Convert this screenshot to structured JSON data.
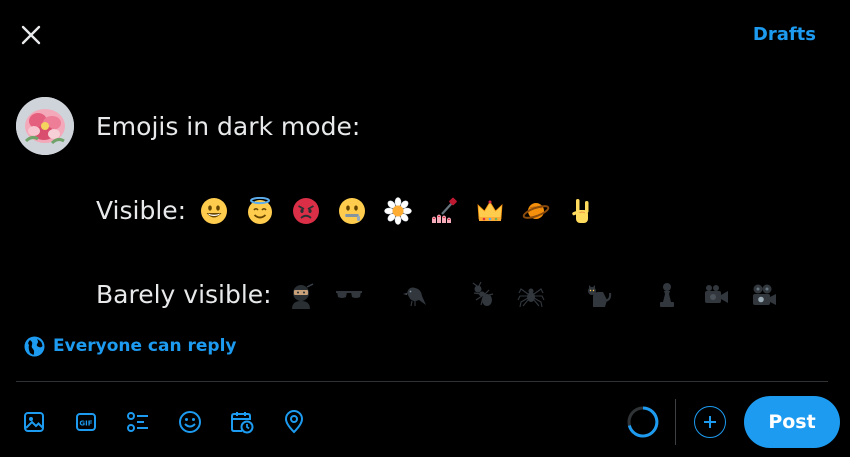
{
  "header": {
    "drafts_label": "Drafts",
    "close_icon": "close-icon"
  },
  "compose": {
    "line1": "Emojis in dark mode:",
    "visible_label": "Visible:",
    "visible_emojis": [
      "grinning-face",
      "smiling-face-with-halo",
      "pouting-face",
      "zipper-mouth-face",
      "daisy",
      "nail-polish",
      "crown",
      "ringed-planet",
      "sign-of-the-horns"
    ],
    "barely_label": "Barely visible:",
    "barely_emojis": [
      "ninja",
      "dark-sunglasses",
      "black-bird",
      "ant",
      "spider",
      "black-cat",
      "chess-pawn",
      "video-camera",
      "movie-camera"
    ]
  },
  "reply_setting": {
    "label": "Everyone can reply",
    "icon": "globe-icon"
  },
  "toolbar": {
    "icons": [
      "image-icon",
      "gif-icon",
      "poll-icon",
      "emoji-icon",
      "schedule-icon",
      "location-icon"
    ],
    "gif_text": "GIF",
    "post_label": "Post"
  },
  "colors": {
    "accent": "#1d9bf0",
    "background": "#000000",
    "text": "#e7e9ea",
    "divider": "#2f3336"
  }
}
